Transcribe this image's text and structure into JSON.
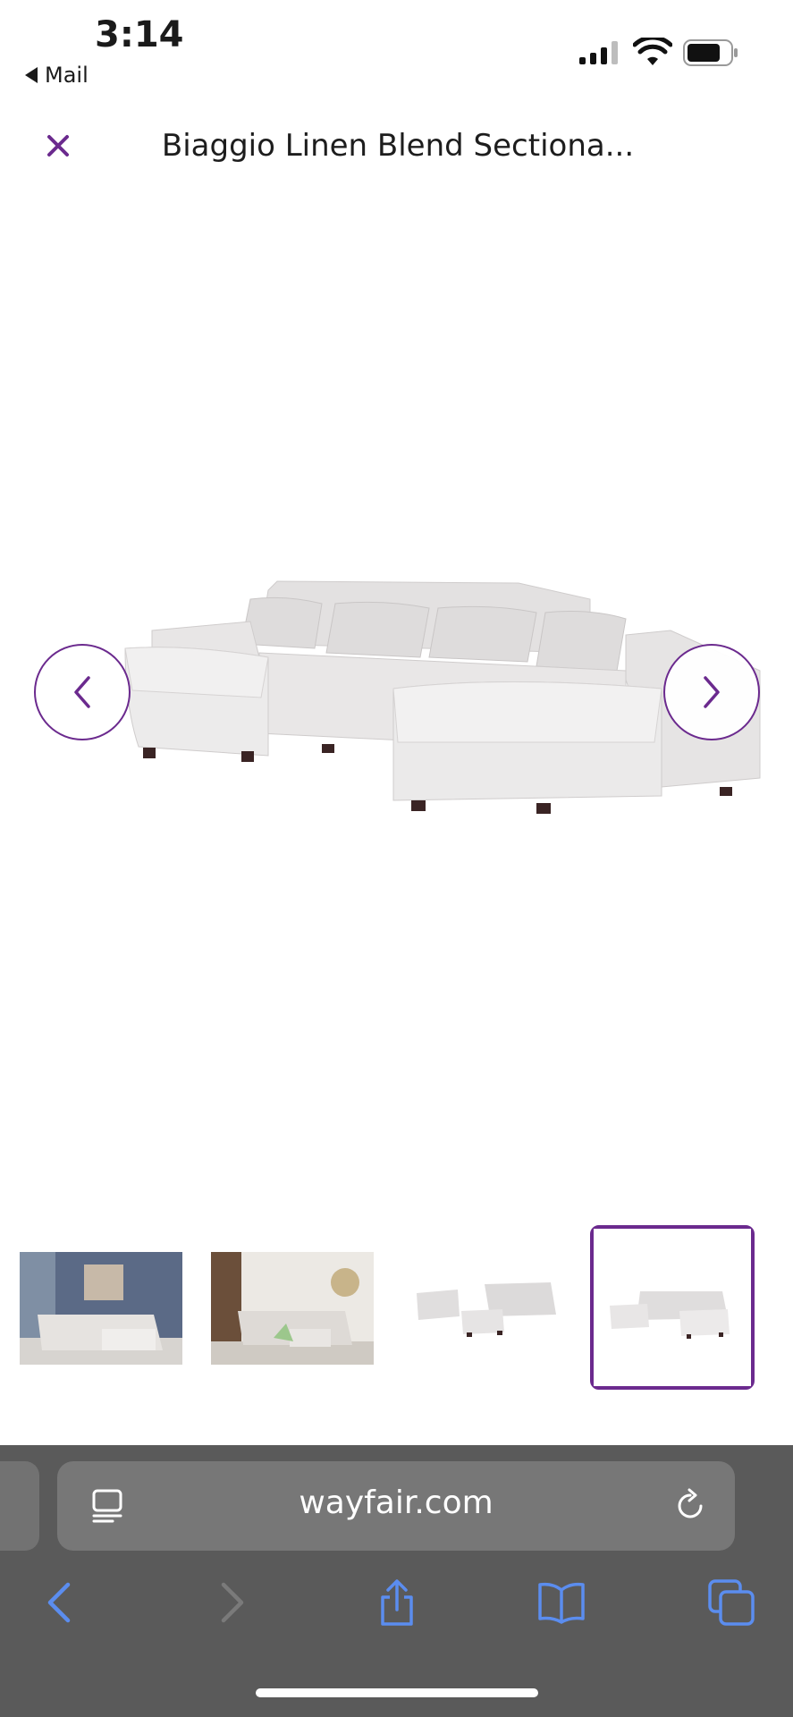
{
  "status_bar": {
    "time": "3:14",
    "back_app": "Mail"
  },
  "header": {
    "title": "Biaggio Linen Blend Sectiona..."
  },
  "gallery": {
    "main_image": "sofa-product-image",
    "thumbnails": [
      {
        "name": "lifestyle-blue-room",
        "selected": false
      },
      {
        "name": "lifestyle-bookshelf-room",
        "selected": false
      },
      {
        "name": "sofa-set-white-background",
        "selected": false
      },
      {
        "name": "sectional-white-background",
        "selected": true
      }
    ]
  },
  "browser": {
    "url": "wayfair.com"
  },
  "colors": {
    "accent": "#6b2a8e",
    "toolbar_bg": "#5a5a5a",
    "url_bar_bg": "#777777",
    "toolbar_icon": "#5b8def"
  }
}
